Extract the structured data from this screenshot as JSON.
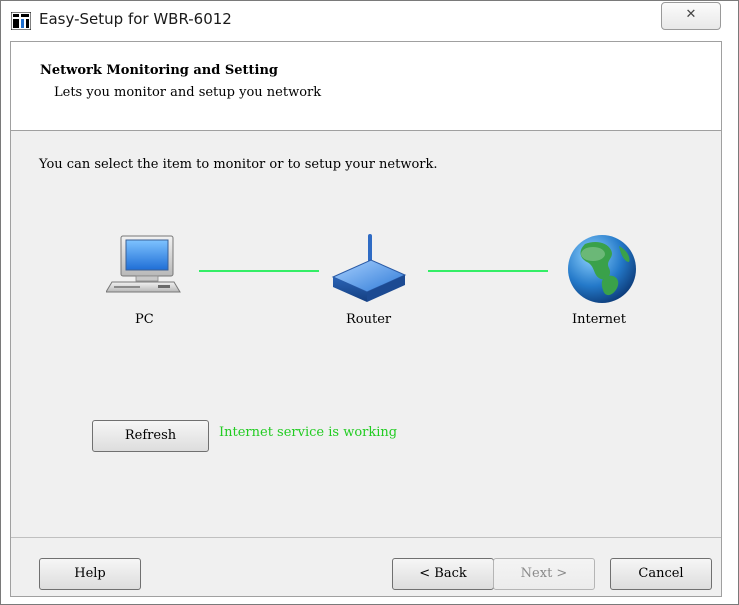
{
  "window": {
    "title": "Easy-Setup for WBR-6012",
    "close_glyph": "✕"
  },
  "header": {
    "title": "Network Monitoring and Setting",
    "subtitle": "Lets you monitor and setup you network"
  },
  "main": {
    "instructions": "You can select the item to monitor or to setup your network.",
    "devices": [
      {
        "label": "PC",
        "icon": "pc-icon"
      },
      {
        "label": "Router",
        "icon": "router-icon"
      },
      {
        "label": "Internet",
        "icon": "globe-icon"
      }
    ],
    "connection_color": "#33ee66",
    "refresh_label": "Refresh",
    "status_text": "Internet service is working",
    "status_color": "#22cc22"
  },
  "footer": {
    "help_label": "Help",
    "back_label": "< Back",
    "next_label": "Next >",
    "cancel_label": "Cancel"
  }
}
